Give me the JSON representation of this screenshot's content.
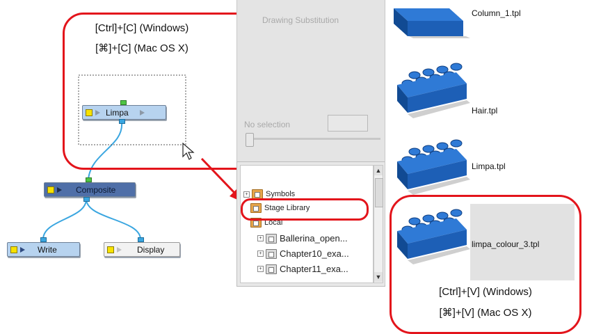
{
  "callouts": {
    "copy_line1": "[Ctrl]+[C] (Windows)",
    "copy_line2": "[⌘]+[C] (Mac OS X)",
    "paste_line1": "[Ctrl]+[V] (Windows)",
    "paste_line2": "[⌘]+[V] (Mac OS X)"
  },
  "nodes": {
    "limpa": "Limpa",
    "composite": "Composite",
    "write": "Write",
    "display": "Display"
  },
  "drawing_substitution": {
    "title": "Drawing Substitution",
    "selection_text": "No selection"
  },
  "library_tree": {
    "items": [
      {
        "label": "Symbols"
      },
      {
        "label": "Stage Library"
      },
      {
        "label": "Local"
      },
      {
        "label": "Ballerina_open..."
      },
      {
        "label": "Chapter10_exa..."
      },
      {
        "label": "Chapter11_exa..."
      }
    ]
  },
  "library_templates": [
    {
      "label": "Column_1.tpl"
    },
    {
      "label": "Hair.tpl"
    },
    {
      "label": "Limpa.tpl"
    },
    {
      "label": "limpa_colour_3.tpl"
    }
  ],
  "colors": {
    "highlight_red": "#e3141b",
    "node_blue": "#b7d3ef",
    "composite_blue": "#4f6fa8",
    "cable_blue": "#3aa6e0",
    "brick_blue": "#1d5fb6"
  },
  "icons": [
    "mouse-cursor-icon",
    "folder-icon",
    "expand-icon",
    "scroll-up-icon",
    "scroll-down-icon",
    "template-brick-icon"
  ]
}
